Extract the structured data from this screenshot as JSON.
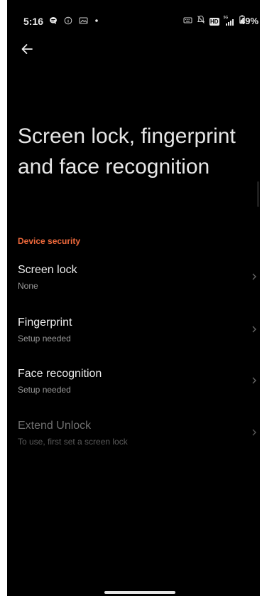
{
  "status_bar": {
    "time": "5:16",
    "battery": "49%",
    "left_icons": [
      "chat-bubble-icon",
      "info-circle-icon",
      "image-icon",
      "dot-icon"
    ],
    "right_icons": [
      "keyboard-icon",
      "bell-off-icon",
      "hd-badge-icon",
      "signal-icon",
      "battery-icon"
    ],
    "hd_label": "HD",
    "network_label": "5G"
  },
  "header": {
    "back_icon": "arrow-left-icon",
    "title": "Screen lock, fingerprint and face recognition"
  },
  "section": {
    "header": "Device security",
    "accent_color": "#f06a3c",
    "items": [
      {
        "title": "Screen lock",
        "subtitle": "None",
        "enabled": true
      },
      {
        "title": "Fingerprint",
        "subtitle": "Setup needed",
        "enabled": true
      },
      {
        "title": "Face recognition",
        "subtitle": "Setup needed",
        "enabled": true
      },
      {
        "title": "Extend Unlock",
        "subtitle": "To use, first set a screen lock",
        "enabled": false
      }
    ]
  }
}
